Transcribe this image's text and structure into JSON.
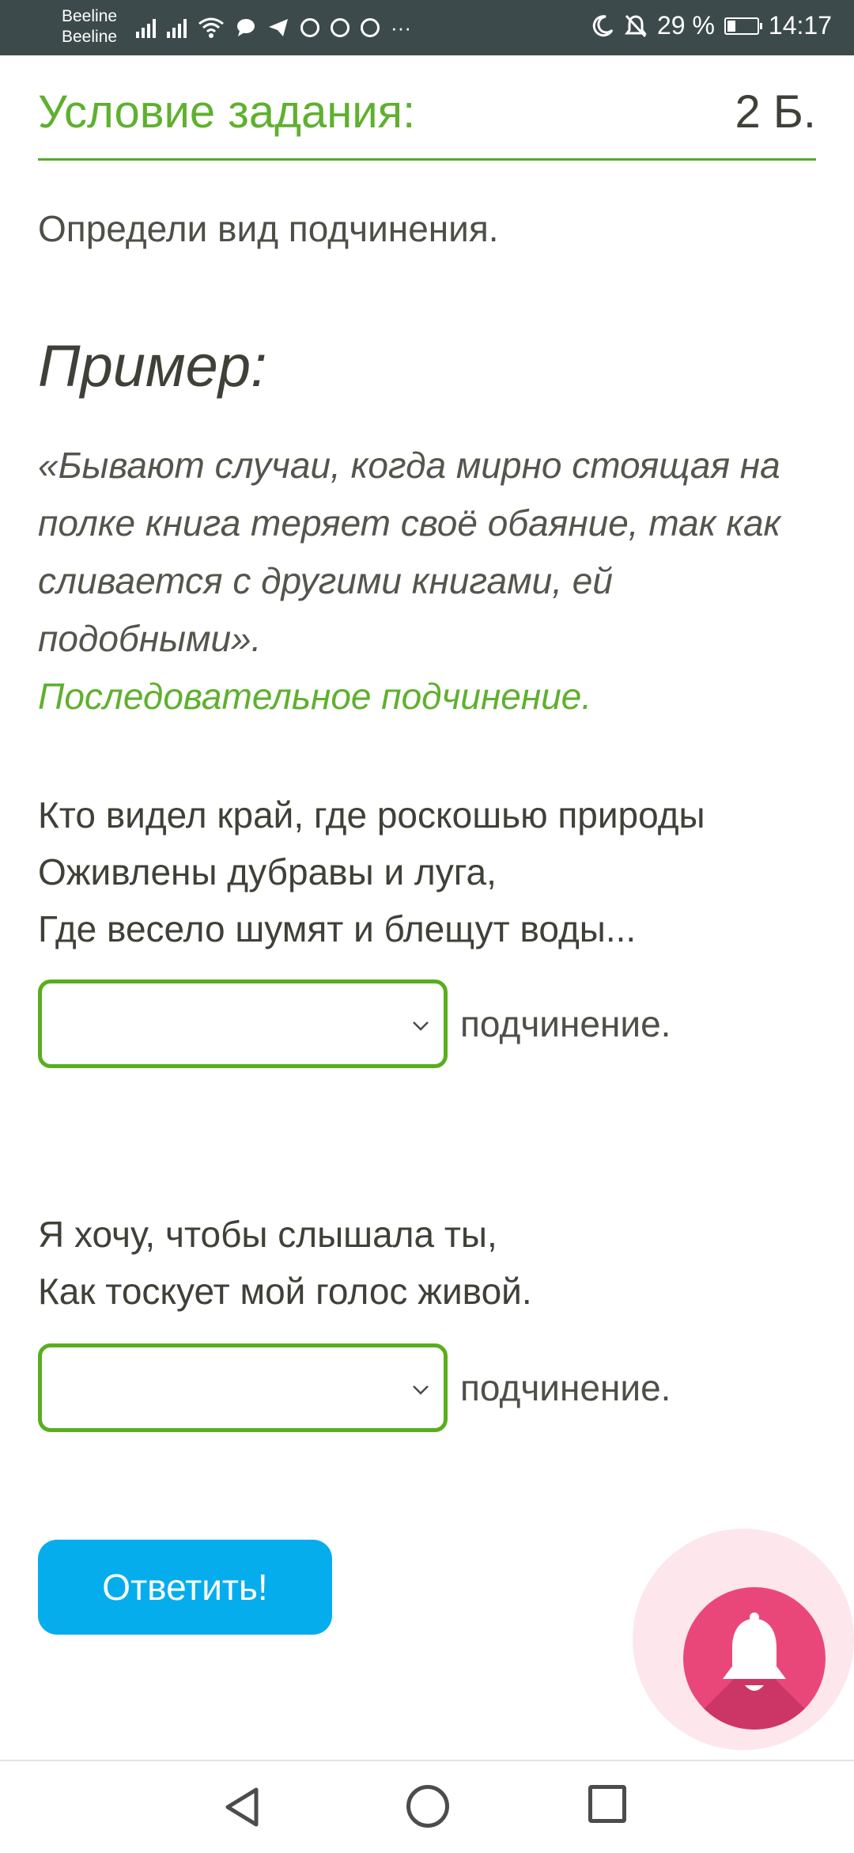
{
  "status_bar": {
    "carrier_1": "Beeline",
    "carrier_2": "Beeline",
    "more_icons": "···",
    "battery": "29 %",
    "battery_level_percent": 29,
    "time": "14:17",
    "icons": [
      "signal-icon",
      "signal-icon",
      "wifi-icon",
      "message-icon",
      "telegram-icon",
      "chrome-icon",
      "chrome-icon",
      "chrome-icon",
      "moon-icon",
      "bell-off-icon",
      "battery-icon"
    ]
  },
  "header": {
    "title": "Условие задания:",
    "points": "2 Б."
  },
  "instruction": "Определи вид подчинения.",
  "example": {
    "heading": "Пример:",
    "text_lines": [
      "«Бывают случаи, когда мирно стоящая на",
      "полке книга теряет своё обаяние, так как",
      "сливается с другими книгами, ей",
      "подобными»."
    ],
    "answer": "Последовательное подчинение."
  },
  "questions": [
    {
      "lines": [
        "Кто видел край, где роскошью природы",
        "Оживлены дубравы и луга,",
        "Где весело шумят и блещут воды..."
      ],
      "select_value": "",
      "suffix": "подчинение."
    },
    {
      "lines": [
        "Я хочу, чтобы слышала ты,",
        "Как тоскует мой голос живой."
      ],
      "select_value": "",
      "suffix": "подчинение."
    }
  ],
  "submit_label": "Ответить!",
  "colors": {
    "accent_green": "#5fb02f",
    "button_blue": "#06adec",
    "bell_pink": "#e9477a",
    "status_bar": "#3d4a4b"
  }
}
